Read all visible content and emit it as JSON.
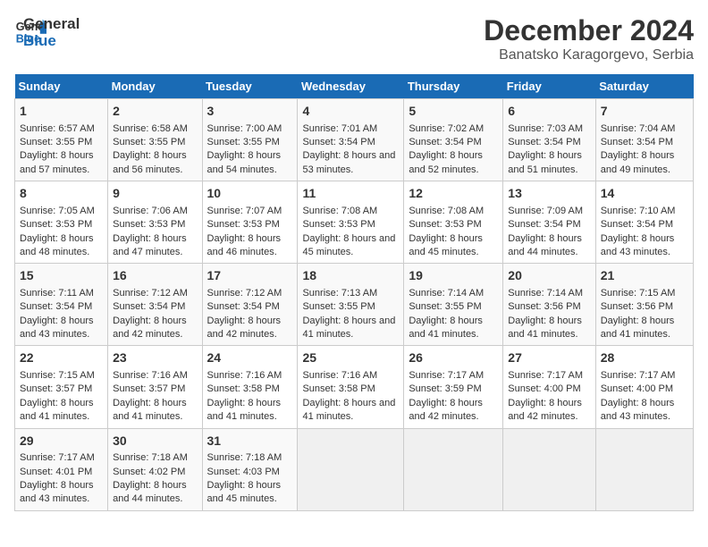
{
  "header": {
    "logo_line1": "General",
    "logo_line2": "Blue",
    "title": "December 2024",
    "subtitle": "Banatsko Karagorgevo, Serbia"
  },
  "days_of_week": [
    "Sunday",
    "Monday",
    "Tuesday",
    "Wednesday",
    "Thursday",
    "Friday",
    "Saturday"
  ],
  "weeks": [
    [
      {
        "day": "1",
        "sunrise": "6:57 AM",
        "sunset": "3:55 PM",
        "daylight": "8 hours and 57 minutes."
      },
      {
        "day": "2",
        "sunrise": "6:58 AM",
        "sunset": "3:55 PM",
        "daylight": "8 hours and 56 minutes."
      },
      {
        "day": "3",
        "sunrise": "7:00 AM",
        "sunset": "3:55 PM",
        "daylight": "8 hours and 54 minutes."
      },
      {
        "day": "4",
        "sunrise": "7:01 AM",
        "sunset": "3:54 PM",
        "daylight": "8 hours and 53 minutes."
      },
      {
        "day": "5",
        "sunrise": "7:02 AM",
        "sunset": "3:54 PM",
        "daylight": "8 hours and 52 minutes."
      },
      {
        "day": "6",
        "sunrise": "7:03 AM",
        "sunset": "3:54 PM",
        "daylight": "8 hours and 51 minutes."
      },
      {
        "day": "7",
        "sunrise": "7:04 AM",
        "sunset": "3:54 PM",
        "daylight": "8 hours and 49 minutes."
      }
    ],
    [
      {
        "day": "8",
        "sunrise": "7:05 AM",
        "sunset": "3:53 PM",
        "daylight": "8 hours and 48 minutes."
      },
      {
        "day": "9",
        "sunrise": "7:06 AM",
        "sunset": "3:53 PM",
        "daylight": "8 hours and 47 minutes."
      },
      {
        "day": "10",
        "sunrise": "7:07 AM",
        "sunset": "3:53 PM",
        "daylight": "8 hours and 46 minutes."
      },
      {
        "day": "11",
        "sunrise": "7:08 AM",
        "sunset": "3:53 PM",
        "daylight": "8 hours and 45 minutes."
      },
      {
        "day": "12",
        "sunrise": "7:08 AM",
        "sunset": "3:53 PM",
        "daylight": "8 hours and 45 minutes."
      },
      {
        "day": "13",
        "sunrise": "7:09 AM",
        "sunset": "3:54 PM",
        "daylight": "8 hours and 44 minutes."
      },
      {
        "day": "14",
        "sunrise": "7:10 AM",
        "sunset": "3:54 PM",
        "daylight": "8 hours and 43 minutes."
      }
    ],
    [
      {
        "day": "15",
        "sunrise": "7:11 AM",
        "sunset": "3:54 PM",
        "daylight": "8 hours and 43 minutes."
      },
      {
        "day": "16",
        "sunrise": "7:12 AM",
        "sunset": "3:54 PM",
        "daylight": "8 hours and 42 minutes."
      },
      {
        "day": "17",
        "sunrise": "7:12 AM",
        "sunset": "3:54 PM",
        "daylight": "8 hours and 42 minutes."
      },
      {
        "day": "18",
        "sunrise": "7:13 AM",
        "sunset": "3:55 PM",
        "daylight": "8 hours and 41 minutes."
      },
      {
        "day": "19",
        "sunrise": "7:14 AM",
        "sunset": "3:55 PM",
        "daylight": "8 hours and 41 minutes."
      },
      {
        "day": "20",
        "sunrise": "7:14 AM",
        "sunset": "3:56 PM",
        "daylight": "8 hours and 41 minutes."
      },
      {
        "day": "21",
        "sunrise": "7:15 AM",
        "sunset": "3:56 PM",
        "daylight": "8 hours and 41 minutes."
      }
    ],
    [
      {
        "day": "22",
        "sunrise": "7:15 AM",
        "sunset": "3:57 PM",
        "daylight": "8 hours and 41 minutes."
      },
      {
        "day": "23",
        "sunrise": "7:16 AM",
        "sunset": "3:57 PM",
        "daylight": "8 hours and 41 minutes."
      },
      {
        "day": "24",
        "sunrise": "7:16 AM",
        "sunset": "3:58 PM",
        "daylight": "8 hours and 41 minutes."
      },
      {
        "day": "25",
        "sunrise": "7:16 AM",
        "sunset": "3:58 PM",
        "daylight": "8 hours and 41 minutes."
      },
      {
        "day": "26",
        "sunrise": "7:17 AM",
        "sunset": "3:59 PM",
        "daylight": "8 hours and 42 minutes."
      },
      {
        "day": "27",
        "sunrise": "7:17 AM",
        "sunset": "4:00 PM",
        "daylight": "8 hours and 42 minutes."
      },
      {
        "day": "28",
        "sunrise": "7:17 AM",
        "sunset": "4:00 PM",
        "daylight": "8 hours and 43 minutes."
      }
    ],
    [
      {
        "day": "29",
        "sunrise": "7:17 AM",
        "sunset": "4:01 PM",
        "daylight": "8 hours and 43 minutes."
      },
      {
        "day": "30",
        "sunrise": "7:18 AM",
        "sunset": "4:02 PM",
        "daylight": "8 hours and 44 minutes."
      },
      {
        "day": "31",
        "sunrise": "7:18 AM",
        "sunset": "4:03 PM",
        "daylight": "8 hours and 45 minutes."
      },
      null,
      null,
      null,
      null
    ]
  ]
}
